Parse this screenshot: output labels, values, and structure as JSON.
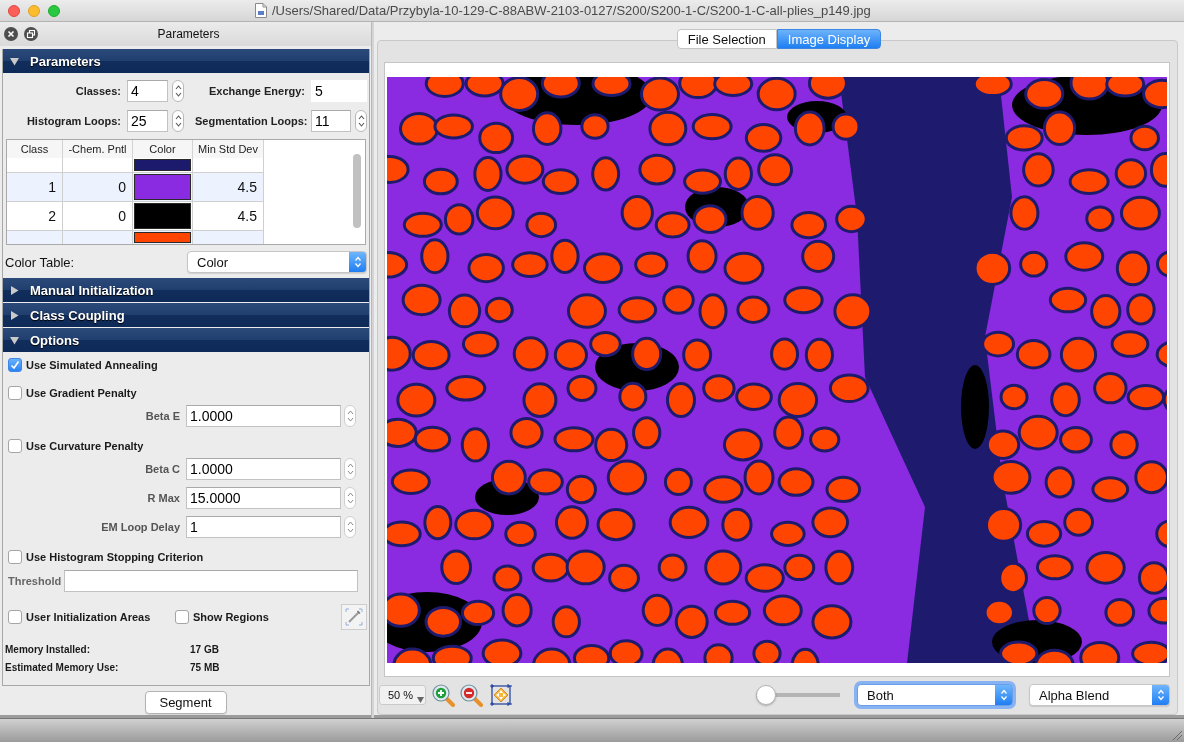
{
  "window": {
    "title": "/Users/Shared/Data/Przybyla-10-129-C-88ABW-2103-0127/S200/S200-1-C/S200-1-C-all-plies_p149.jpg"
  },
  "panel": {
    "title": "Parameters"
  },
  "sections": [
    {
      "kind": "parameters",
      "title": "Parameters",
      "expanded": true
    },
    {
      "kind": "manual_initialization",
      "title": "Manual Initialization",
      "expanded": false
    },
    {
      "kind": "class_coupling",
      "title": "Class Coupling",
      "expanded": false
    },
    {
      "kind": "options",
      "title": "Options",
      "expanded": true
    }
  ],
  "parameters": {
    "fields": [
      {
        "label": "Classes:",
        "value": "4",
        "stepper": true
      },
      {
        "label": "Exchange Energy:",
        "value": "5",
        "stepper": false
      },
      {
        "label": "Histogram Loops:",
        "value": "25",
        "stepper": true
      },
      {
        "label": "Segmentation Loops:",
        "value": "11",
        "stepper": true
      }
    ],
    "table": {
      "columns": [
        "Class",
        "-Chem. Pntl",
        "Color",
        "Min Std Dev"
      ],
      "rows": [
        {
          "color": "#1c1a6c"
        },
        {
          "class": "1",
          "chem_pntl": "0",
          "color": "#8a2be2",
          "min_std_dev": "4.5"
        },
        {
          "class": "2",
          "chem_pntl": "0",
          "color": "#000000",
          "min_std_dev": "4.5"
        },
        {
          "color": "#ff4500"
        }
      ]
    },
    "color_table": {
      "label": "Color Table:",
      "value": "Color"
    }
  },
  "options": {
    "items": [
      {
        "kind": "checkbox",
        "label": "Use Simulated Annealing",
        "checked": true
      },
      {
        "kind": "checkbox",
        "label": "Use Gradient Penalty",
        "checked": false
      },
      {
        "kind": "number",
        "label": "Beta E",
        "value": "1.0000"
      },
      {
        "kind": "checkbox",
        "label": "Use Curvature Penalty",
        "checked": false
      },
      {
        "kind": "number",
        "label": "Beta C",
        "value": "1.0000"
      },
      {
        "kind": "number",
        "label": "R Max",
        "value": "15.0000"
      },
      {
        "kind": "number",
        "label": "EM Loop Delay",
        "value": "1"
      },
      {
        "kind": "checkbox",
        "label": "Use Histogram Stopping Criterion",
        "checked": false
      },
      {
        "kind": "text",
        "label": "Threshold"
      },
      {
        "kind": "checkbox_row",
        "checkboxes": [
          {
            "label": "User Initialization Areas",
            "checked": false
          },
          {
            "label": "Show Regions",
            "checked": false
          }
        ]
      }
    ],
    "memory": [
      {
        "label": "Memory Installed:",
        "value": "17 GB"
      },
      {
        "label": "Estimated Memory Use:",
        "value": "75 MB"
      }
    ]
  },
  "segment_button": {
    "label": "Segment"
  },
  "tabs": [
    {
      "label": "File Selection",
      "selected": false
    },
    {
      "label": "Image Display",
      "selected": true
    }
  ],
  "image_display": {
    "zoom": "50 %",
    "slider": {
      "level": 0
    },
    "display_mode": {
      "value": "Both",
      "focused": true
    },
    "blend_mode": {
      "value": "Alpha Blend",
      "focused": false
    }
  }
}
